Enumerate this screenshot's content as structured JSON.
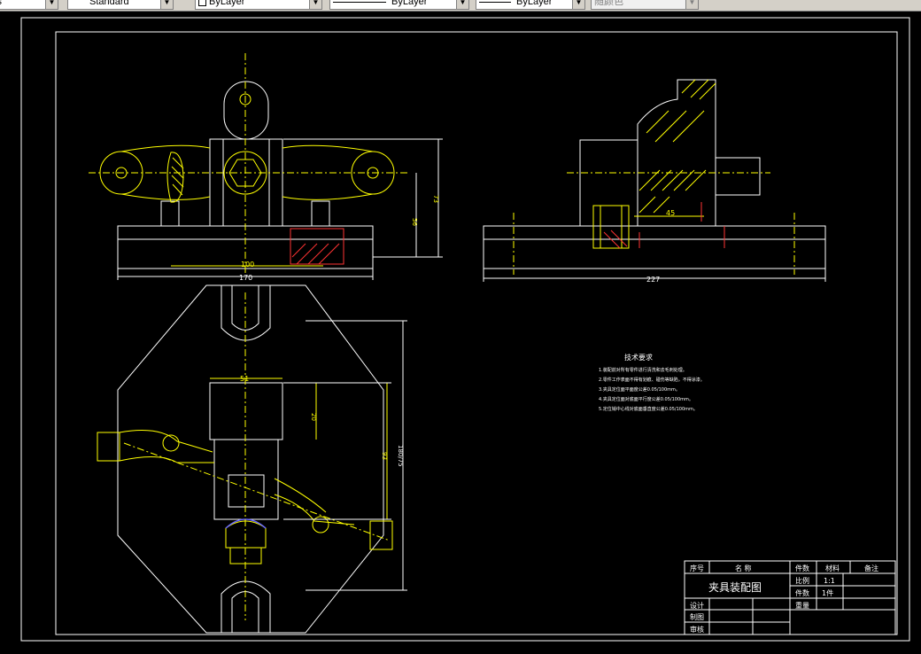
{
  "toolbar": {
    "text_style": "Standard",
    "layer": "ByLayer",
    "linetype": "ByLayer",
    "lineweight": "ByLayer",
    "plot_color": "随颜色"
  },
  "drawing": {
    "dims": {
      "top_width": "170",
      "top_inner": "100",
      "top_h1": "56",
      "top_h2": "73",
      "side_len": "227",
      "side_short": "45",
      "plan_w": "51",
      "plan_h": "20",
      "plan_v1": "93",
      "plan_v2": "180/75"
    },
    "tech_notes": {
      "title": "技术要求",
      "lines": [
        "1.装配前对所有零件进行清洗和去毛刺处理。",
        "2.零件工作表面不得有划痕、碰伤等缺陷，不得涂漆。",
        "3.夹具定位面平面度公差0.05/100mm。",
        "4.夹具定位面对底面平行度公差0.05/100mm。",
        "5.定位销中心线对底面垂直度公差0.05/100mm。"
      ]
    },
    "title_block": {
      "h_seq": "序号",
      "h_name": "名 称",
      "h_qty": "件数",
      "h_material": "材料",
      "h_remark": "备注",
      "drawing_name": "夹具装配图",
      "scale_label": "比例",
      "scale_value": "1:1",
      "pieces_label": "件数",
      "pieces_value": "1件",
      "weight_label": "重量",
      "design_label": "设计",
      "drafter_label": "制图",
      "check_label": "审核"
    }
  }
}
